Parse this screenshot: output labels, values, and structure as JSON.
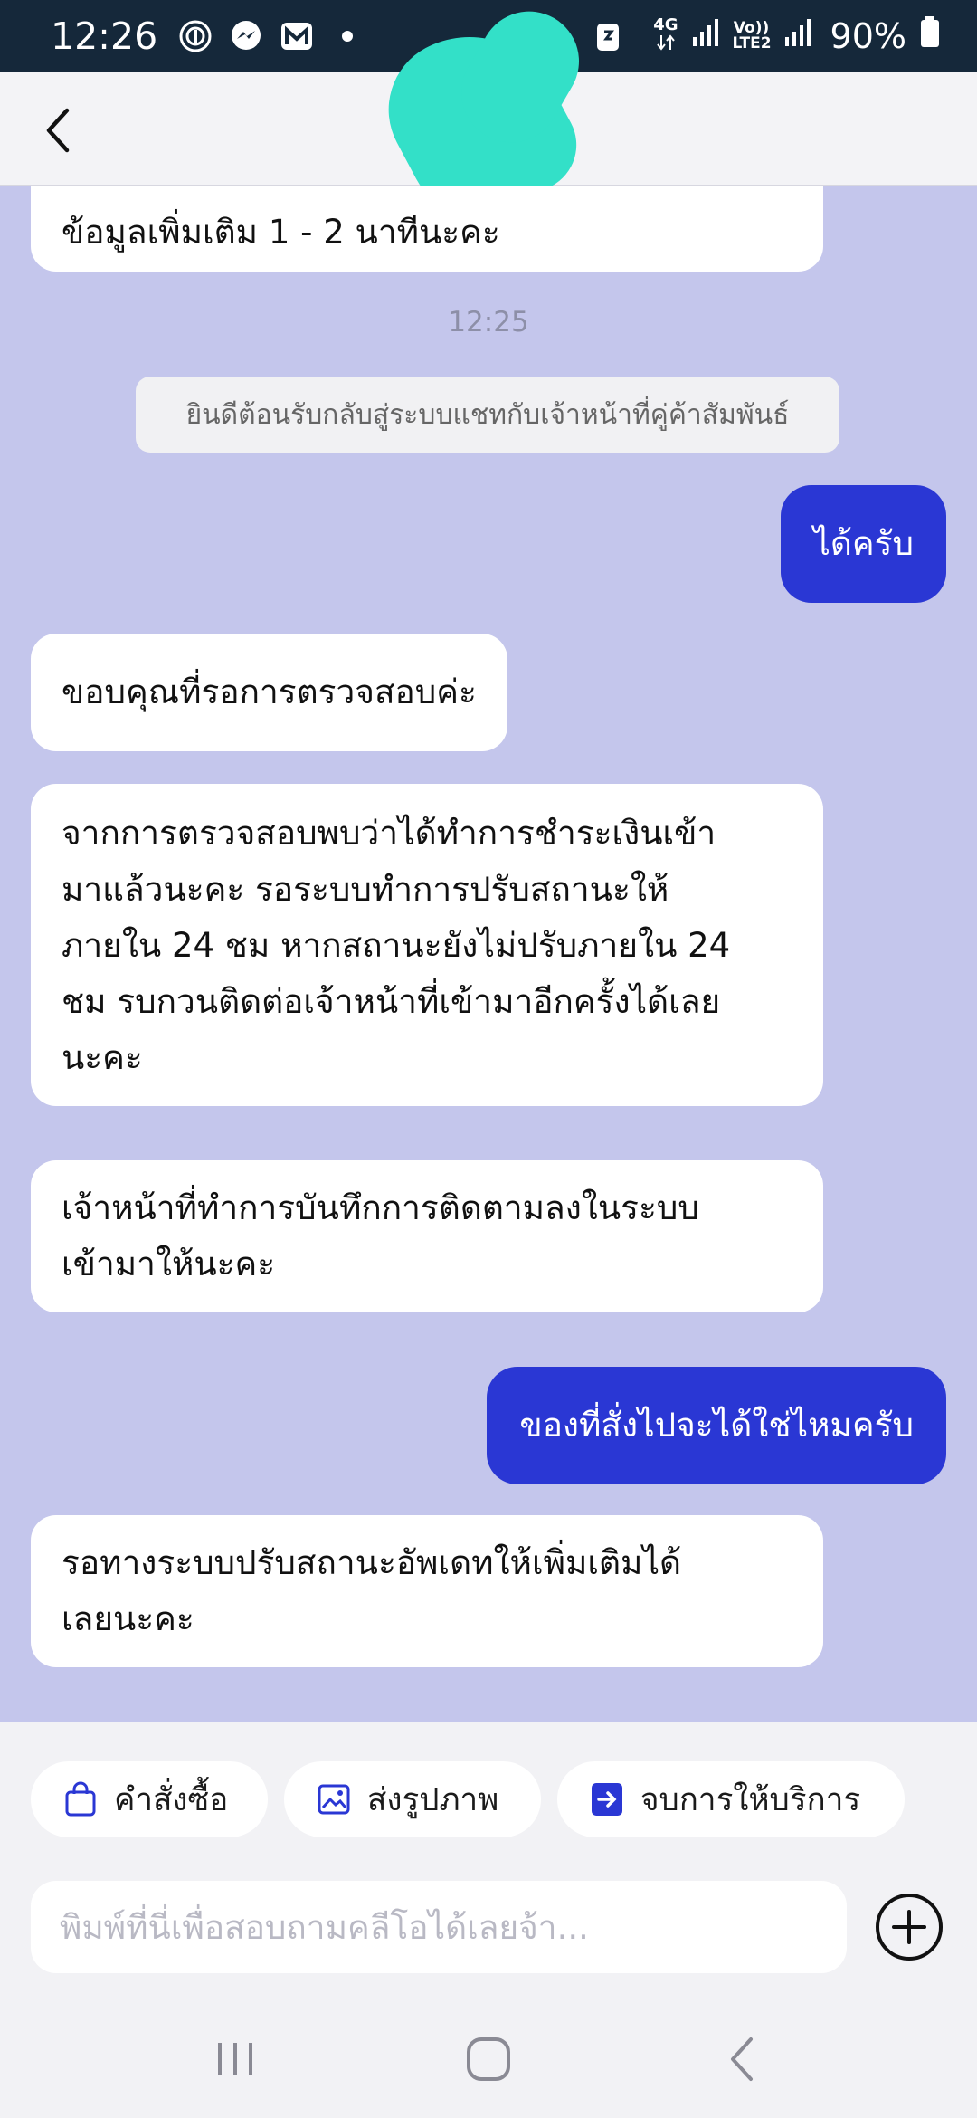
{
  "status_bar": {
    "time": "12:26",
    "network_4g": "4G",
    "volte": "Vo)) LTE2",
    "battery": "90%"
  },
  "header": {
    "back_icon": "chevron-left-icon"
  },
  "chat": {
    "messages": [
      {
        "side": "in",
        "text": "ข้อมูลเพิ่มเติม 1 - 2 นาทีนะคะ"
      },
      {
        "side": "time",
        "text": "12:25"
      },
      {
        "side": "system",
        "text": "ยินดีต้อนรับกลับสู่ระบบแชทกับเจ้าหน้าที่คู่ค้าสัมพันธ์"
      },
      {
        "side": "out",
        "text": "ได้ครับ"
      },
      {
        "side": "in",
        "text": "ขอบคุณที่รอการตรวจสอบค่ะ"
      },
      {
        "side": "in",
        "lines": [
          "จากการตรวจสอบพบว่าได้ทำการชำระเงินเข้า",
          "มาแล้วนะคะ รอระบบทำการปรับสถานะให้",
          "ภายใน 24 ชม หากสถานะยังไม่ปรับภายใน 24",
          "ชม รบกวนติดต่อเจ้าหน้าที่เข้ามาอีกครั้งได้เลย",
          "นะคะ"
        ]
      },
      {
        "side": "in",
        "lines": [
          "เจ้าหน้าที่ทำการบันทึกการติดตามลงในระบบ",
          "เข้ามาให้นะคะ"
        ]
      },
      {
        "side": "out",
        "text": "ของที่สั่งไปจะได้ใช่ไหมครับ"
      },
      {
        "side": "in",
        "lines": [
          "รอทางระบบปรับสถานะอัพเดทให้เพิ่มเติมได้",
          "เลยนะคะ"
        ]
      }
    ]
  },
  "actions": {
    "orders": "คำสั่งซื้อ",
    "send_image": "ส่งรูปภาพ",
    "end_service": "จบการให้บริการ"
  },
  "composer": {
    "placeholder": "พิมพ์ที่นี่เพื่อสอบถามคลีโอได้เลยจ้า...",
    "value": ""
  },
  "colors": {
    "chat_bg": "#c4c6ec",
    "outgoing_bubble": "#2a37d4",
    "accent": "#2a37d4"
  }
}
